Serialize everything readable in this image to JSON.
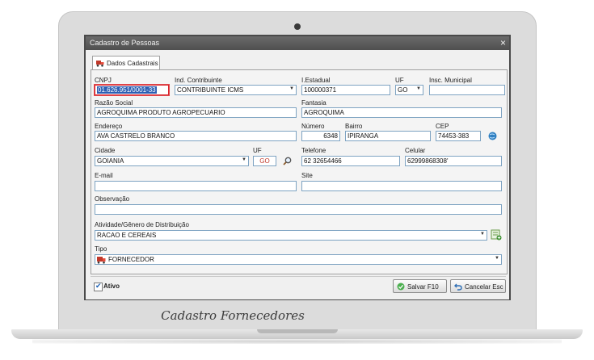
{
  "window": {
    "title": "Cadastro de Pessoas",
    "close_glyph": "×"
  },
  "tabs": [
    {
      "label": "Dados Cadastrais",
      "icon": "truck-icon"
    }
  ],
  "form": {
    "cnpj": {
      "label": "CNPJ",
      "value": "01.626.951/0001-33"
    },
    "ind_contribuinte": {
      "label": "Ind. Contribuinte",
      "value": "CONTRIBUINTE ICMS"
    },
    "i_estadual": {
      "label": "I.Estadual",
      "value": "100000371"
    },
    "uf_top": {
      "label": "UF",
      "value": "GO"
    },
    "insc_municipal": {
      "label": "Insc. Municipal",
      "value": ""
    },
    "razao_social": {
      "label": "Razão Social",
      "value": "AGROQUIMA PRODUTO AGROPECUARIO"
    },
    "fantasia": {
      "label": "Fantasia",
      "value": "AGROQUIMA"
    },
    "endereco": {
      "label": "Endereço",
      "value": "AVA CASTRELO BRANCO"
    },
    "numero": {
      "label": "Número",
      "value": "6348"
    },
    "bairro": {
      "label": "Bairro",
      "value": "IPIRANGA"
    },
    "cep": {
      "label": "CEP",
      "value": "74453-383"
    },
    "cidade": {
      "label": "Cidade",
      "value": "GOIANIA"
    },
    "uf_city": {
      "label": "UF",
      "value": "GO"
    },
    "telefone": {
      "label": "Telefone",
      "value": "62 32654466"
    },
    "celular": {
      "label": "Celular",
      "value": "62999868308'"
    },
    "email": {
      "label": "E-mail",
      "value": ""
    },
    "site": {
      "label": "Site",
      "value": ""
    },
    "observacao": {
      "label": "Observação",
      "value": ""
    },
    "atividade": {
      "label": "Atividade/Gênero de Distribuição",
      "value": "RACAO E CEREAIS"
    },
    "tipo": {
      "label": "Tipo",
      "value": "FORNECEDOR"
    }
  },
  "footer": {
    "ativo_label": "Ativo",
    "ativo_checked": true,
    "save_label": "Salvar F10",
    "cancel_label": "Cancelar Esc"
  },
  "caption": "Cadastro Fornecedores",
  "colors": {
    "titlebar": "#5a5a5a",
    "field_border": "#7ea3c2",
    "highlight": "#d9252c",
    "uf_text": "#c0392b"
  }
}
